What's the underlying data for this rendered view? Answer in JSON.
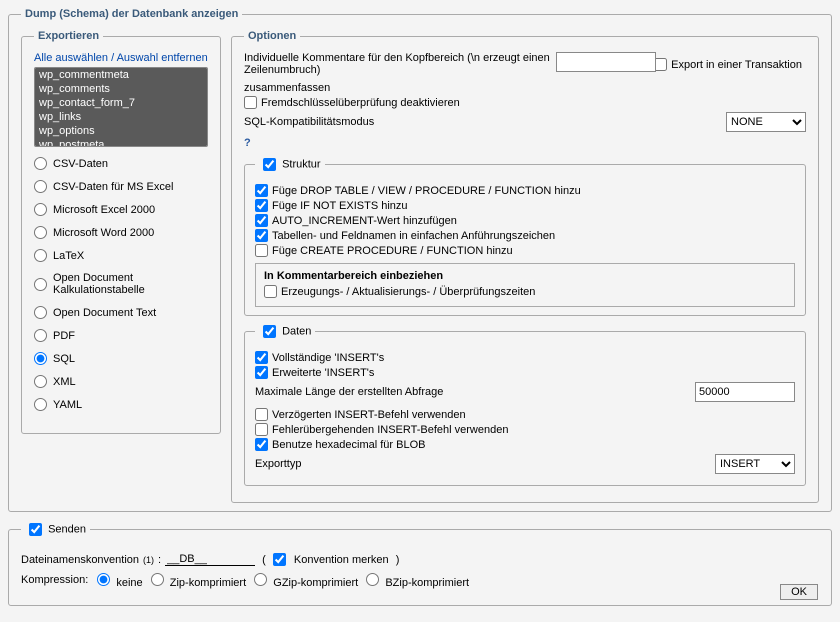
{
  "main_legend": "Dump (Schema) der Datenbank anzeigen",
  "export": {
    "legend": "Exportieren",
    "select_all": "Alle auswählen",
    "unselect_all": "Auswahl entfernen",
    "tables": [
      "wp_commentmeta",
      "wp_comments",
      "wp_contact_form_7",
      "wp_links",
      "wp_options",
      "wp_postmeta"
    ],
    "formats": [
      "CSV-Daten",
      "CSV-Daten für MS Excel",
      "Microsoft Excel 2000",
      "Microsoft Word 2000",
      "LaTeX",
      "Open Document Kalkulationstabelle",
      "Open Document Text",
      "PDF",
      "SQL",
      "XML",
      "YAML"
    ],
    "selected_format": "SQL"
  },
  "options": {
    "legend": "Optionen",
    "comment_label": "Individuelle Kommentare für den Kopfbereich (\\n erzeugt einen Zeilenumbruch)",
    "comment_value": "",
    "transaction": "Export in einer Transaktion",
    "zusammenfassen": "zusammenfassen",
    "disable_fk": "Fremdschlüsselüberprüfung deaktivieren",
    "sql_compat_label": "SQL-Kompatibilitätsmodus",
    "sql_compat_value": "NONE",
    "help": "?"
  },
  "struktur": {
    "legend": "Struktur",
    "drop": "Füge DROP TABLE / VIEW / PROCEDURE / FUNCTION hinzu",
    "ifnotexists": "Füge IF NOT EXISTS hinzu",
    "autoinc": "AUTO_INCREMENT-Wert hinzufügen",
    "quotes": "Tabellen- und Feldnamen in einfachen Anführungszeichen",
    "createproc": "Füge CREATE PROCEDURE / FUNCTION hinzu",
    "commentbox_title": "In Kommentarbereich einbeziehen",
    "commentbox_opt": "Erzeugungs- / Aktualisierungs- / Überprüfungszeiten"
  },
  "daten": {
    "legend": "Daten",
    "complete": "Vollständige 'INSERT's",
    "extended": "Erweiterte 'INSERT's",
    "maxlen_label": "Maximale Länge der erstellten Abfrage",
    "maxlen_value": "50000",
    "delayed": "Verzögerten INSERT-Befehl verwenden",
    "ignore": "Fehlerübergehenden INSERT-Befehl verwenden",
    "hex": "Benutze hexadecimal für BLOB",
    "exporttype_label": "Exporttyp",
    "exporttype_value": "INSERT"
  },
  "send": {
    "legend": "Senden",
    "filename_label": "Dateinamenskonvention",
    "filename_sup": "(1)",
    "filename_value": "__DB__",
    "remember": "Konvention merken",
    "compression_label": "Kompression:",
    "compression_opts": [
      "keine",
      "Zip-komprimiert",
      "GZip-komprimiert",
      "BZip-komprimiert"
    ],
    "compression_selected": "keine"
  },
  "ok": "OK"
}
